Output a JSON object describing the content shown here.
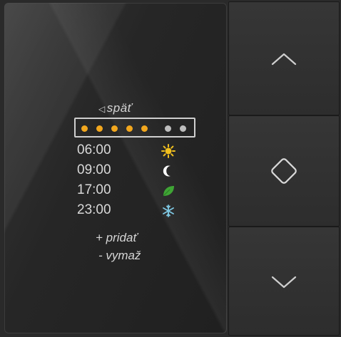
{
  "screen": {
    "back_label": "späť",
    "back_icon": "triangle-left-icon",
    "schedule_dots": [
      {
        "color": "#f2a71e",
        "active": true
      },
      {
        "color": "#f2a71e",
        "active": true
      },
      {
        "color": "#f2a71e",
        "active": true
      },
      {
        "color": "#f2a71e",
        "active": true
      },
      {
        "color": "#f2a71e",
        "active": true
      },
      {
        "color": "#bdbdbd",
        "active": false
      },
      {
        "color": "#bdbdbd",
        "active": false
      }
    ],
    "schedule": [
      {
        "time": "06:00",
        "icon": "sun-icon",
        "color": "#f2c01e"
      },
      {
        "time": "09:00",
        "icon": "moon-icon",
        "color": "#ffffff"
      },
      {
        "time": "17:00",
        "icon": "leaf-icon",
        "color": "#3fa535"
      },
      {
        "time": "23:00",
        "icon": "snowflake-icon",
        "color": "#7ec8e3"
      }
    ],
    "add_label": "+ pridať",
    "delete_label": "- vymaž"
  },
  "buttons": [
    {
      "name": "up",
      "icon": "chevron-up-icon"
    },
    {
      "name": "ok",
      "icon": "diamond-icon"
    },
    {
      "name": "down",
      "icon": "chevron-down-icon"
    }
  ],
  "colors": {
    "active_dot": "#f2a71e",
    "inactive_dot": "#bdbdbd",
    "text": "#d9d9d9"
  }
}
